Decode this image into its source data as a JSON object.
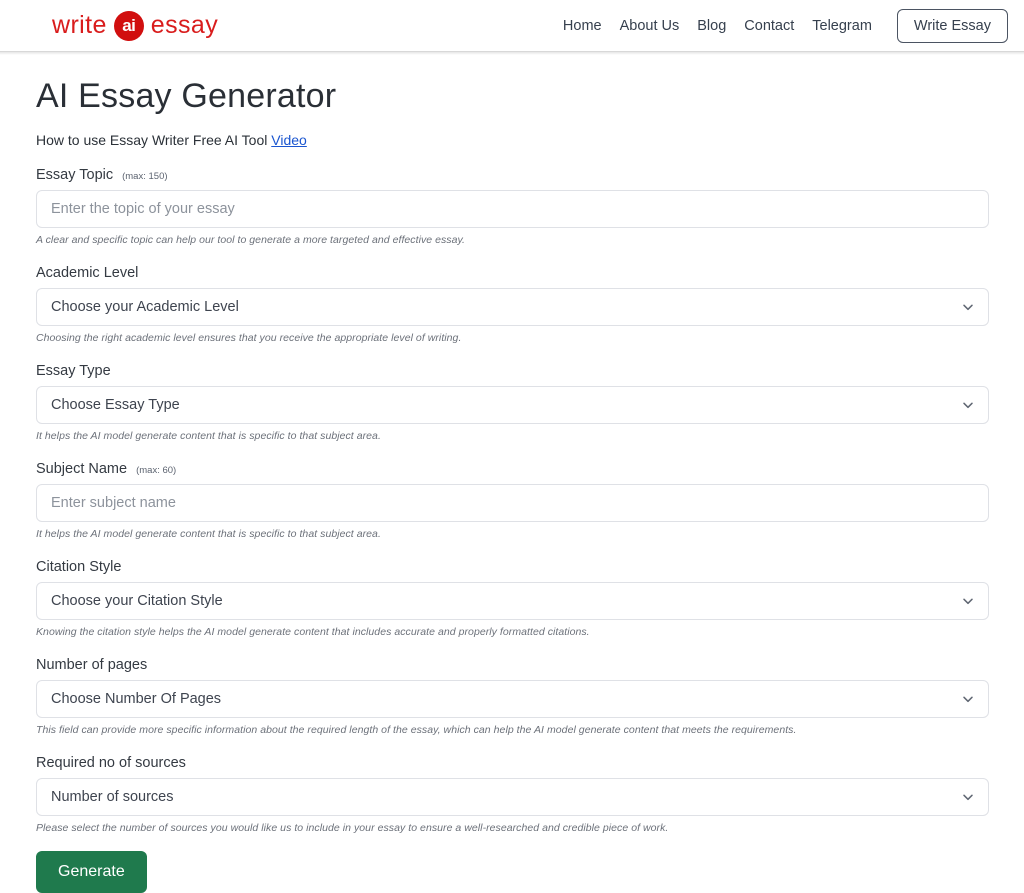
{
  "header": {
    "logo": {
      "word_left": "write",
      "badge": "ai",
      "word_right": "essay"
    },
    "nav_links": [
      {
        "label": "Home"
      },
      {
        "label": "About Us"
      },
      {
        "label": "Blog"
      },
      {
        "label": "Contact"
      },
      {
        "label": "Telegram"
      }
    ],
    "cta_label": "Write Essay"
  },
  "main": {
    "title": "AI Essay Generator",
    "howto_text": "How to use Essay Writer Free AI Tool ",
    "howto_link": "Video",
    "fields": [
      {
        "label": "Essay Topic",
        "max": "(max: 150)",
        "type": "input",
        "placeholder": "Enter the topic of your essay",
        "help": "A clear and specific topic can help our tool to generate a more targeted and effective essay."
      },
      {
        "label": "Academic Level",
        "max": "",
        "type": "select",
        "placeholder": "Choose your Academic Level",
        "help": "Choosing the right academic level ensures that you receive the appropriate level of writing."
      },
      {
        "label": "Essay Type",
        "max": "",
        "type": "select",
        "placeholder": "Choose Essay Type",
        "help": "It helps the AI model generate content that is specific to that subject area."
      },
      {
        "label": "Subject Name",
        "max": "(max: 60)",
        "type": "input",
        "placeholder": "Enter subject name",
        "help": "It helps the AI model generate content that is specific to that subject area."
      },
      {
        "label": "Citation Style",
        "max": "",
        "type": "select",
        "placeholder": "Choose your Citation Style",
        "help": "Knowing the citation style helps the AI model generate content that includes accurate and properly formatted citations."
      },
      {
        "label": "Number of pages",
        "max": "",
        "type": "select",
        "placeholder": "Choose Number Of Pages",
        "help": "This field can provide more specific information about the required length of the essay, which can help the AI model generate content that meets the requirements."
      },
      {
        "label": "Required no of sources",
        "max": "",
        "type": "select",
        "placeholder": "Number of sources",
        "help": "Please select the number of sources you would like us to include in your essay to ensure a well-researched and credible piece of work."
      }
    ],
    "generate_label": "Generate"
  },
  "colors": {
    "brand_red": "#d10f0f",
    "link_blue": "#1a55d0",
    "generate_green": "#1f7a4d"
  }
}
